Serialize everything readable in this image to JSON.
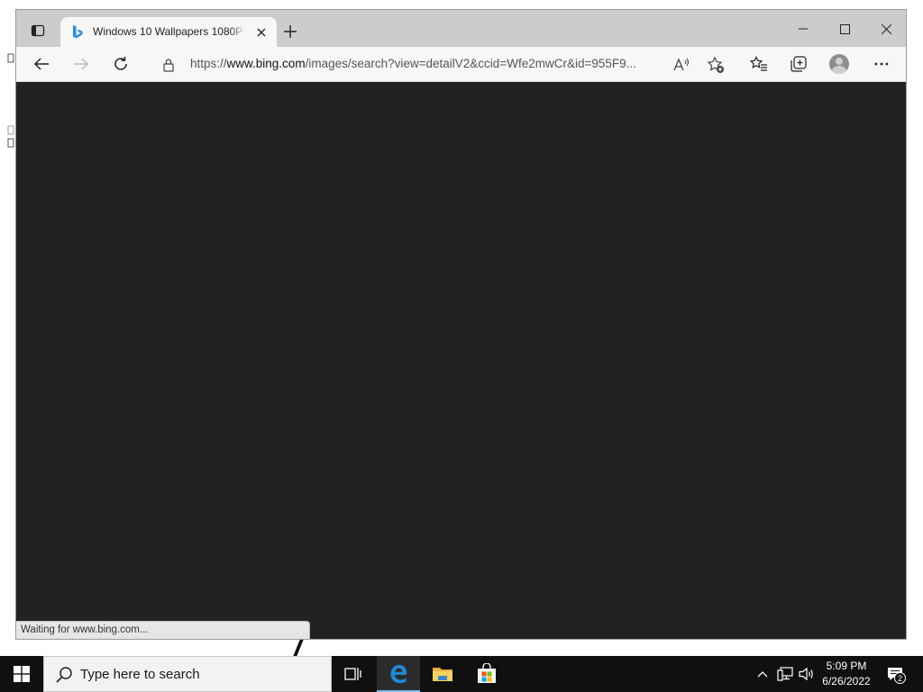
{
  "browser": {
    "tab": {
      "title": "Windows 10 Wallpapers 1080P -",
      "favicon": "bing-icon"
    },
    "address_bar": {
      "url_prefix": "https://",
      "url_domain": "www.bing.com",
      "url_rest": "/images/search?view=detailV2&ccid=Wfe2mwCr&id=955F9..."
    },
    "status_text": "Waiting for www.bing.com...",
    "content_background": "#222222"
  },
  "taskbar": {
    "search_placeholder": "Type here to search",
    "clock_time": "5:09 PM",
    "clock_date": "6/26/2022",
    "notification_count": "2"
  }
}
